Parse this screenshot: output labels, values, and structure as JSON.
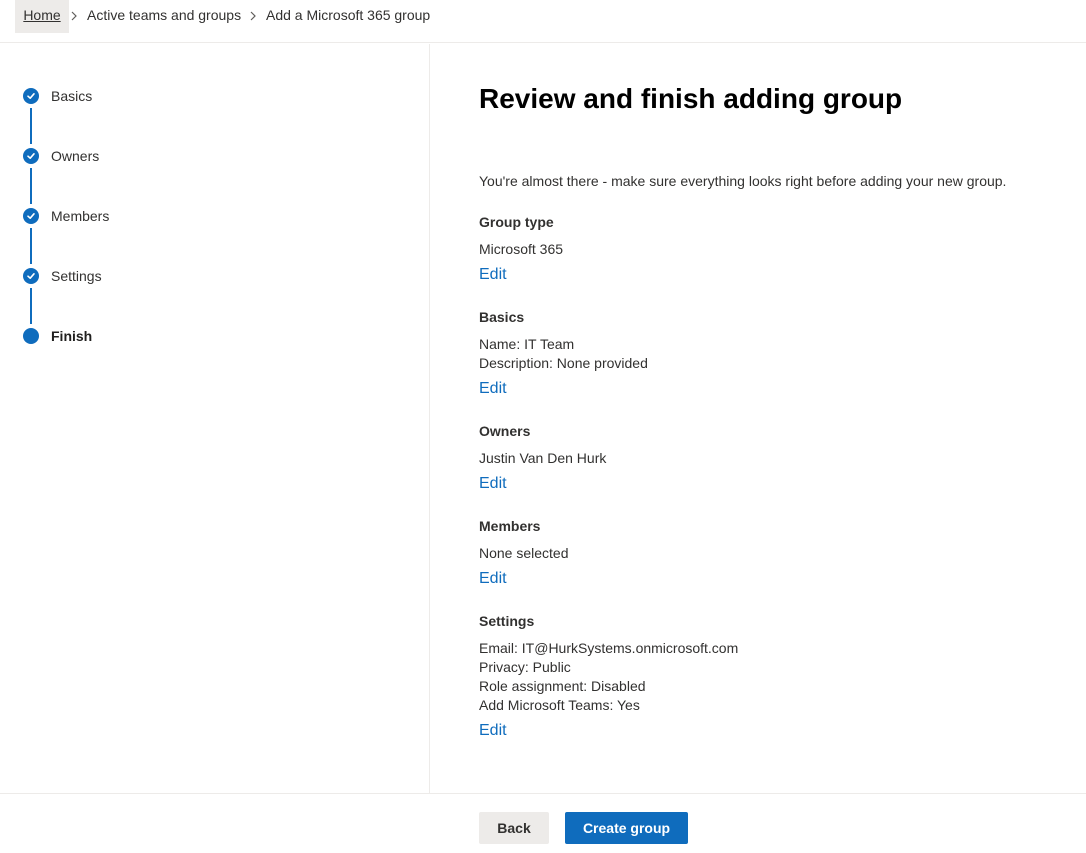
{
  "breadcrumb": {
    "items": [
      "Home",
      "Active teams and groups",
      "Add a Microsoft 365 group"
    ]
  },
  "steps": [
    {
      "label": "Basics",
      "state": "completed"
    },
    {
      "label": "Owners",
      "state": "completed"
    },
    {
      "label": "Members",
      "state": "completed"
    },
    {
      "label": "Settings",
      "state": "completed"
    },
    {
      "label": "Finish",
      "state": "current"
    }
  ],
  "main": {
    "title": "Review and finish adding group",
    "intro": "You're almost there - make sure everything looks right before adding your new group.",
    "edit_label": "Edit",
    "sections": [
      {
        "title": "Group type",
        "lines": [
          "Microsoft 365"
        ]
      },
      {
        "title": "Basics",
        "lines": [
          "Name: IT Team",
          "Description: None provided"
        ]
      },
      {
        "title": "Owners",
        "lines": [
          "Justin Van Den Hurk"
        ]
      },
      {
        "title": "Members",
        "lines": [
          "None selected"
        ]
      },
      {
        "title": "Settings",
        "lines": [
          "Email: IT@HurkSystems.onmicrosoft.com",
          "Privacy: Public",
          "Role assignment: Disabled",
          "Add Microsoft Teams: Yes"
        ]
      }
    ]
  },
  "footer": {
    "back_label": "Back",
    "create_label": "Create group"
  },
  "colors": {
    "accent": "#0f6cbd",
    "divider": "#edebe9",
    "secondary_button": "#edebe9"
  },
  "icons": {
    "breadcrumb_separator": "chevron-right-icon",
    "completed_step": "checkmark-icon",
    "current_step": "filled-circle-icon"
  }
}
